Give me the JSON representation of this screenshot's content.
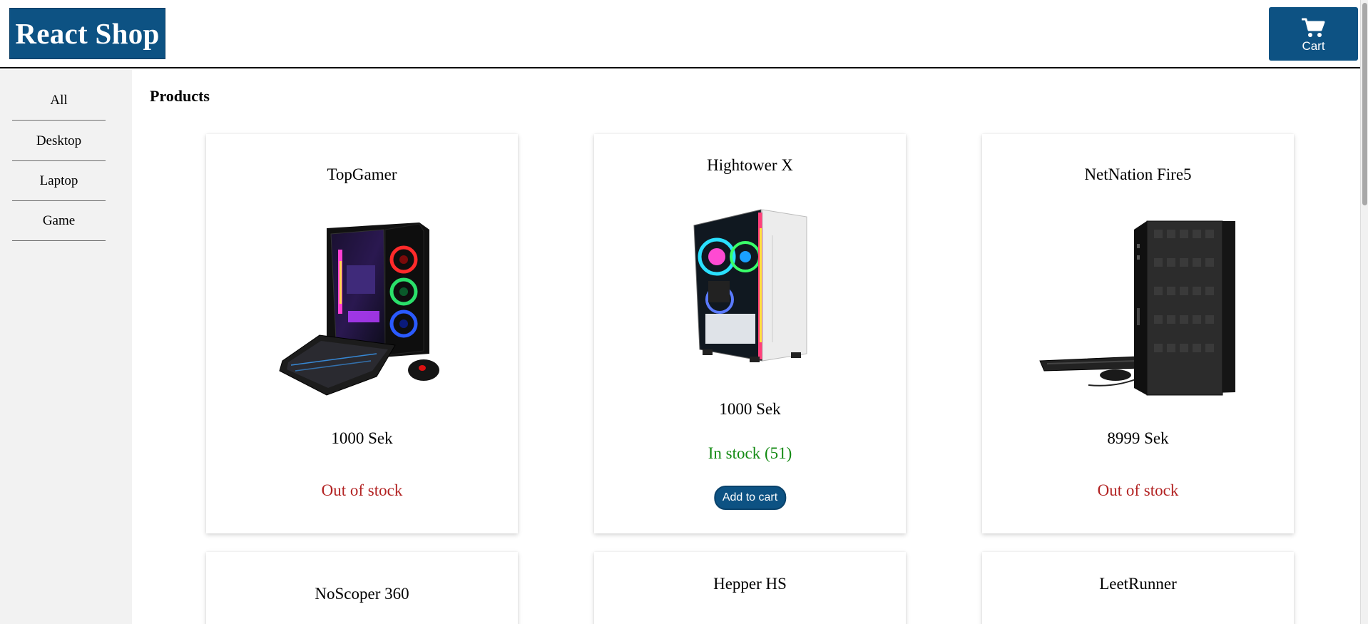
{
  "brand": {
    "title": "React Shop",
    "color": "#0d5283"
  },
  "header": {
    "cart_label": "Cart",
    "cart_icon": "shopping-cart-icon"
  },
  "sidebar": {
    "items": [
      {
        "label": "All"
      },
      {
        "label": "Desktop"
      },
      {
        "label": "Laptop"
      },
      {
        "label": "Game"
      }
    ]
  },
  "main": {
    "title": "Products",
    "products": [
      {
        "name": "TopGamer",
        "price": "1000 Sek",
        "stock": "Out of stock",
        "image": "gaming-pc-rgb-with-keyboard-mouse"
      },
      {
        "name": "Hightower X",
        "price": "1000 Sek",
        "stock": "In stock (51)",
        "button": "Add to cart",
        "image": "white-rgb-tower-pc"
      },
      {
        "name": "NetNation Fire5",
        "price": "8999 Sek",
        "stock": "Out of stock",
        "image": "black-tower-pc-with-keyboard"
      },
      {
        "name": "NoScoper 360"
      },
      {
        "name": "Hepper HS"
      },
      {
        "name": "LeetRunner"
      }
    ]
  },
  "colors": {
    "out_of_stock": "#b22222",
    "in_stock": "#128a12",
    "button": "#0d5283"
  }
}
